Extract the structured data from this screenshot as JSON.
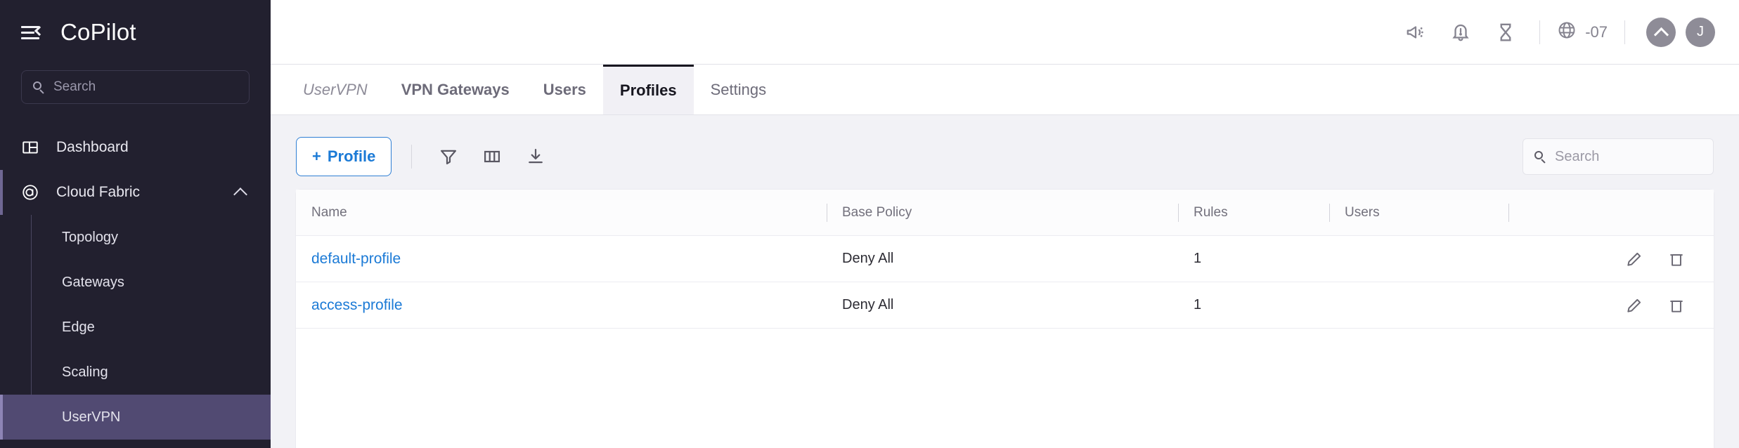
{
  "sidebar": {
    "brand": "CoPilot",
    "menu_icon": "hamburger-collapse-icon",
    "search": {
      "placeholder": "Search",
      "icon": "search-icon"
    },
    "items": [
      {
        "label": "Dashboard",
        "icon": "dashboard-icon",
        "level": "top"
      },
      {
        "label": "Cloud Fabric",
        "icon": "target-icon",
        "level": "group",
        "expanded": true,
        "caret": "chevron-up-icon"
      },
      {
        "label": "Topology",
        "level": "sub"
      },
      {
        "label": "Gateways",
        "level": "sub"
      },
      {
        "label": "Edge",
        "level": "sub"
      },
      {
        "label": "Scaling",
        "level": "sub"
      },
      {
        "label": "UserVPN",
        "level": "sub",
        "selected": true
      }
    ]
  },
  "topbar": {
    "icons": [
      {
        "name": "announcement-megaphone-icon"
      },
      {
        "name": "notification-bell-alert-icon"
      },
      {
        "name": "hourglass-icon"
      }
    ],
    "timezone": {
      "icon": "globe-icon",
      "label": "-07"
    },
    "collapse": {
      "icon": "chevron-up-circle-icon"
    },
    "avatar": {
      "initial": "J"
    }
  },
  "tabs": [
    {
      "label": "UserVPN",
      "style": "breadcrumb"
    },
    {
      "label": "VPN Gateways",
      "style": "strong"
    },
    {
      "label": "Users",
      "style": "normal"
    },
    {
      "label": "Profiles",
      "style": "active"
    },
    {
      "label": "Settings",
      "style": "normal"
    }
  ],
  "toolbar": {
    "add_label": "+ Profile",
    "add_plus": "+",
    "add_text": "Profile",
    "icons": [
      {
        "name": "filter-funnel-icon"
      },
      {
        "name": "columns-icon"
      },
      {
        "name": "download-icon"
      }
    ],
    "search": {
      "placeholder": "Search",
      "icon": "search-icon"
    }
  },
  "table": {
    "columns": [
      "Name",
      "Base Policy",
      "Rules",
      "Users",
      ""
    ],
    "rows": [
      {
        "name": "default-profile",
        "base_policy": "Deny All",
        "rules": "1",
        "users": "",
        "actions": [
          "edit-pencil-icon",
          "delete-trash-icon"
        ]
      },
      {
        "name": "access-profile",
        "base_policy": "Deny All",
        "rules": "1",
        "users": "",
        "actions": [
          "edit-pencil-icon",
          "delete-trash-icon"
        ]
      }
    ]
  },
  "colors": {
    "sidebar_bg": "#22202f",
    "sidebar_selected": "#514a72",
    "accent_blue": "#1b7ad6",
    "page_bg": "#f2f2f6",
    "active_tab_bg": "#f1f0f5"
  }
}
